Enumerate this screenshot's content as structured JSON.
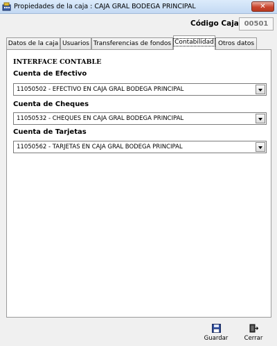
{
  "window": {
    "title": "Propiedades de la caja : CAJA GRAL BODEGA PRINCIPAL",
    "close_label": "✕"
  },
  "codigo": {
    "label": "Código Caja",
    "value": "00501"
  },
  "tabs": [
    {
      "label": "Datos de la caja",
      "active": false
    },
    {
      "label": "Usuarios",
      "active": false
    },
    {
      "label": "Transferencias de fondos",
      "active": false
    },
    {
      "label": "Contabilidad",
      "active": true
    },
    {
      "label": "Otros datos",
      "active": false
    }
  ],
  "contabilidad": {
    "section_title": "INTERFACE CONTABLE",
    "efectivo": {
      "label": "Cuenta de Efectivo",
      "value": "11050502 - EFECTIVO EN CAJA GRAL BODEGA PRINCIPAL"
    },
    "cheques": {
      "label": "Cuenta de Cheques",
      "value": "11050532 - CHEQUES EN CAJA GRAL BODEGA PRINCIPAL"
    },
    "tarjetas": {
      "label": "Cuenta de Tarjetas",
      "value": "11050562 - TARJETAS EN CAJA GRAL BODEGA PRINCIPAL"
    }
  },
  "actions": {
    "guardar": "Guardar",
    "cerrar": "Cerrar"
  },
  "icons": {
    "app": "cash-box-icon",
    "save": "floppy-disk-icon",
    "exit": "exit-door-icon"
  },
  "colors": {
    "titlebar": "#c3d9f3",
    "close_button": "#c9452e",
    "tab_panel": "#ffffff"
  }
}
